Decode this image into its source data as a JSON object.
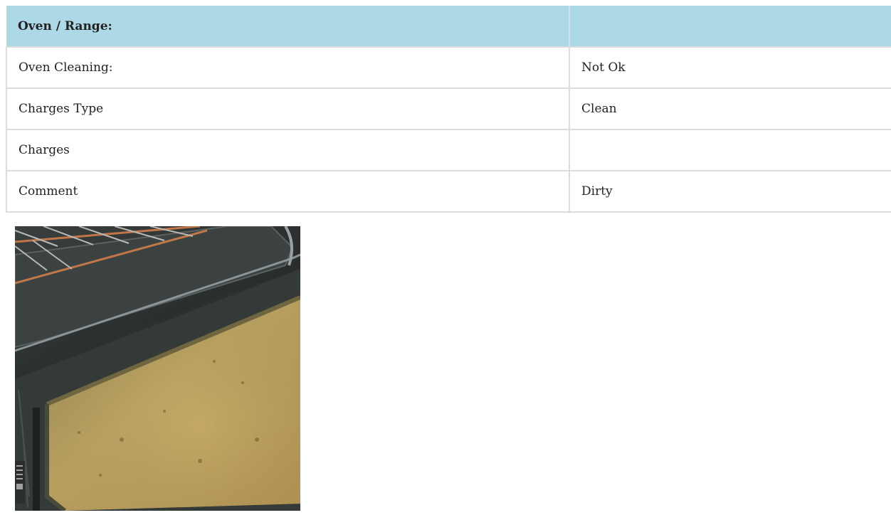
{
  "section": {
    "title": "Oven / Range:",
    "header_value": ""
  },
  "rows": [
    {
      "label": "Oven Cleaning:",
      "value": "Not Ok"
    },
    {
      "label": "Charges Type",
      "value": "Clean"
    },
    {
      "label": "Charges",
      "value": ""
    },
    {
      "label": "Comment",
      "value": "Dirty"
    }
  ],
  "photo": {
    "subject": "dirty oven interior with rack"
  }
}
